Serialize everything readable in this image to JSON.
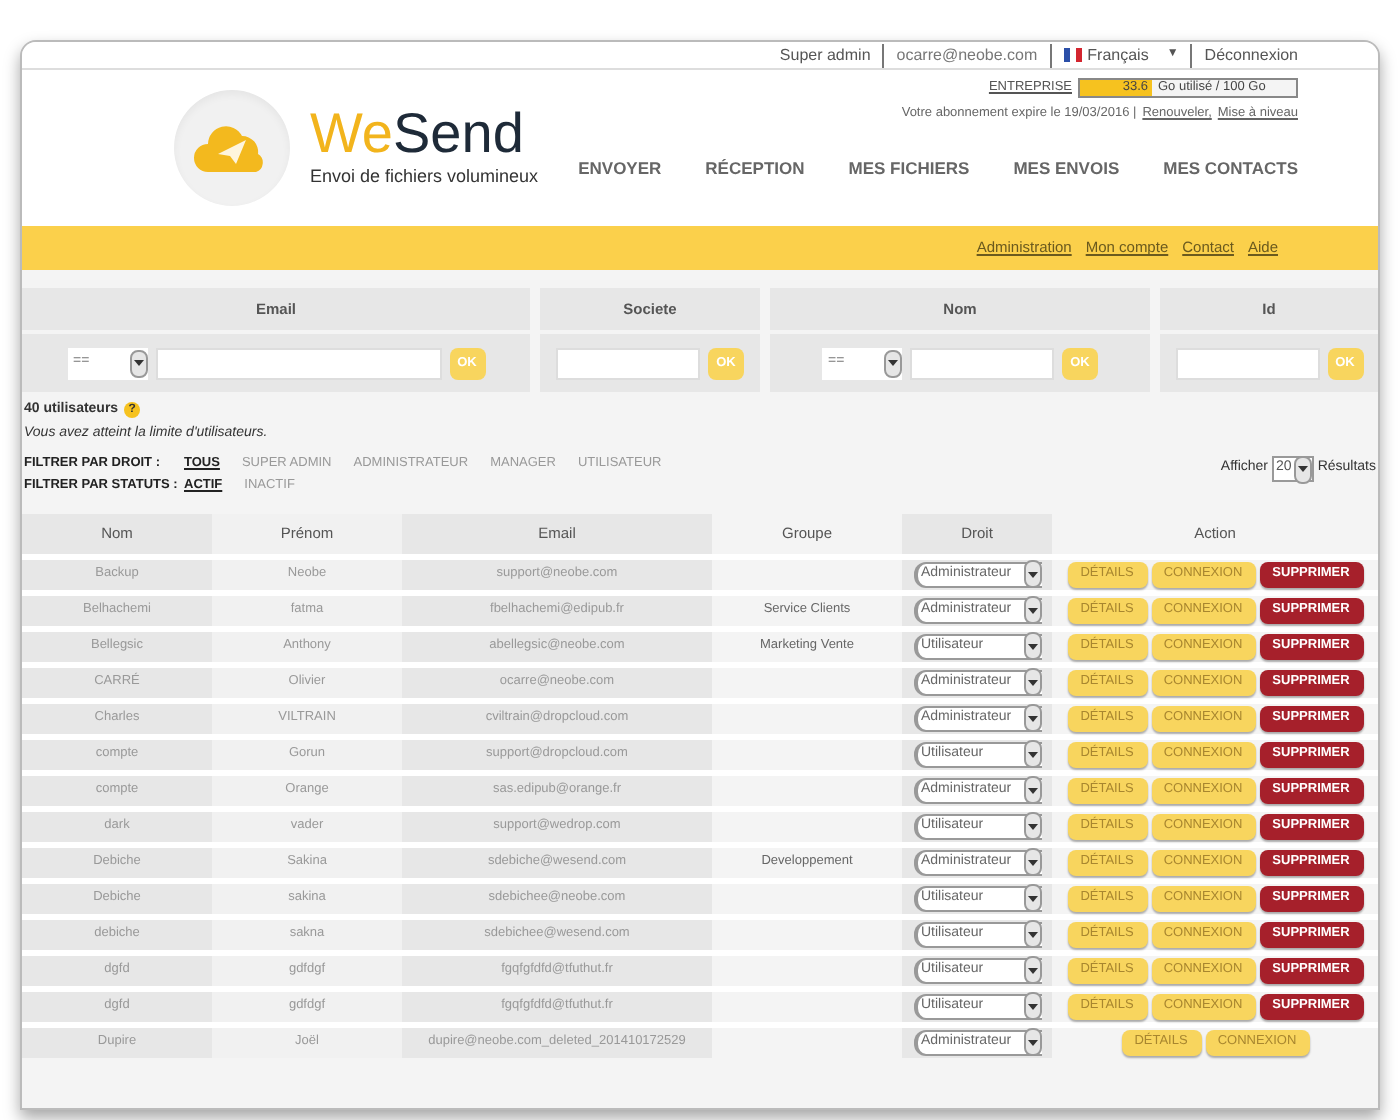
{
  "top_bar": {
    "role": "Super admin",
    "email": "ocarre@neobe.com",
    "language": "Français",
    "language_caret": "▼",
    "logout": "Déconnexion"
  },
  "quota": {
    "plan": "ENTREPRISE",
    "used": "33.6",
    "level": 0.336,
    "label": "Go utilisé / 100 Go"
  },
  "subscription": {
    "text": "Votre abonnement expire le 19/03/2016 |",
    "links": [
      "Renouveler,",
      "Mise à niveau"
    ]
  },
  "logo": {
    "part_1": "We",
    "part_2": "Send",
    "tagline": "Envoi de fichiers volumineux"
  },
  "nav": [
    "ENVOYER",
    "RÉCEPTION",
    "MES FICHIERS",
    "MES ENVOIS",
    "MES CONTACTS"
  ],
  "sub_nav": [
    "Administration",
    "Mon compte",
    "Contact",
    "Aide"
  ],
  "filters": [
    {
      "label": "Email",
      "operator": "==",
      "button": "OK"
    },
    {
      "label": "Societe",
      "button": "OK"
    },
    {
      "label": "Nom",
      "operator": "==",
      "button": "OK"
    },
    {
      "label": "Id",
      "button": "OK"
    }
  ],
  "user_count": "40 utilisateurs",
  "help": "?",
  "limit_note": "Vous avez atteint la limite d'utilisateurs.",
  "right_filter": {
    "label": "FILTRER PAR DROIT :",
    "options": [
      {
        "label": "TOUS",
        "selected": true
      },
      {
        "label": "SUPER ADMIN",
        "selected": false
      },
      {
        "label": "ADMINISTRATEUR",
        "selected": false
      },
      {
        "label": "MANAGER",
        "selected": false
      },
      {
        "label": "UTILISATEUR",
        "selected": false
      }
    ]
  },
  "status_filter": {
    "label": "FILTRER PAR STATUTS :",
    "options": [
      {
        "label": "ACTIF",
        "selected": true
      },
      {
        "label": "INACTIF",
        "selected": false
      }
    ]
  },
  "page_size": {
    "label": "Afficher",
    "value": "20",
    "suffix": "Résultats"
  },
  "table": {
    "columns": [
      "Nom",
      "Prénom",
      "Email",
      "Groupe",
      "Droit",
      "Action"
    ],
    "rows": [
      {
        "nom": "Backup",
        "prenom": "Neobe",
        "email": "support@neobe.com",
        "droit": "Administrateur",
        "actions": [
          {
            "kind": "details",
            "label": "DÉTAILS"
          },
          {
            "kind": "login",
            "label": "CONNEXION"
          },
          {
            "kind": "delete",
            "label": "SUPPRIMER"
          }
        ]
      },
      {
        "nom": "Belhachemi",
        "prenom": "fatma",
        "email": "fbelhachemi@edipub.fr",
        "groupe": "Service Clients",
        "droit": "Administrateur",
        "actions": [
          {
            "kind": "details",
            "label": "DÉTAILS"
          },
          {
            "kind": "login",
            "label": "CONNEXION"
          },
          {
            "kind": "delete",
            "label": "SUPPRIMER"
          }
        ]
      },
      {
        "nom": "Bellegsic",
        "prenom": "Anthony",
        "email": "abellegsic@neobe.com",
        "groupe": "Marketing Vente",
        "droit": "Utilisateur",
        "actions": [
          {
            "kind": "details",
            "label": "DÉTAILS"
          },
          {
            "kind": "login",
            "label": "CONNEXION"
          },
          {
            "kind": "delete",
            "label": "SUPPRIMER"
          }
        ]
      },
      {
        "nom": "CARRÉ",
        "prenom": "Olivier",
        "email": "ocarre@neobe.com",
        "droit": "Administrateur",
        "actions": [
          {
            "kind": "details",
            "label": "DÉTAILS"
          },
          {
            "kind": "login",
            "label": "CONNEXION"
          },
          {
            "kind": "delete",
            "label": "SUPPRIMER"
          }
        ]
      },
      {
        "nom": "Charles",
        "prenom": "VILTRAIN",
        "email": "cviltrain@dropcloud.com",
        "droit": "Administrateur",
        "actions": [
          {
            "kind": "details",
            "label": "DÉTAILS"
          },
          {
            "kind": "login",
            "label": "CONNEXION"
          },
          {
            "kind": "delete",
            "label": "SUPPRIMER"
          }
        ]
      },
      {
        "nom": "compte",
        "prenom": "Gorun",
        "email": "support@dropcloud.com",
        "droit": "Utilisateur",
        "actions": [
          {
            "kind": "details",
            "label": "DÉTAILS"
          },
          {
            "kind": "login",
            "label": "CONNEXION"
          },
          {
            "kind": "delete",
            "label": "SUPPRIMER"
          }
        ]
      },
      {
        "nom": "compte",
        "prenom": "Orange",
        "email": "sas.edipub@orange.fr",
        "droit": "Administrateur",
        "actions": [
          {
            "kind": "details",
            "label": "DÉTAILS"
          },
          {
            "kind": "login",
            "label": "CONNEXION"
          },
          {
            "kind": "delete",
            "label": "SUPPRIMER"
          }
        ]
      },
      {
        "nom": "dark",
        "prenom": "vader",
        "email": "support@wedrop.com",
        "droit": "Utilisateur",
        "actions": [
          {
            "kind": "details",
            "label": "DÉTAILS"
          },
          {
            "kind": "login",
            "label": "CONNEXION"
          },
          {
            "kind": "delete",
            "label": "SUPPRIMER"
          }
        ]
      },
      {
        "nom": "Debiche",
        "prenom": "Sakina",
        "email": "sdebiche@wesend.com",
        "groupe": "Developpement",
        "droit": "Administrateur",
        "actions": [
          {
            "kind": "details",
            "label": "DÉTAILS"
          },
          {
            "kind": "login",
            "label": "CONNEXION"
          },
          {
            "kind": "delete",
            "label": "SUPPRIMER"
          }
        ]
      },
      {
        "nom": "Debiche",
        "prenom": "sakina",
        "email": "sdebichee@neobe.com",
        "droit": "Utilisateur",
        "actions": [
          {
            "kind": "details",
            "label": "DÉTAILS"
          },
          {
            "kind": "login",
            "label": "CONNEXION"
          },
          {
            "kind": "delete",
            "label": "SUPPRIMER"
          }
        ]
      },
      {
        "nom": "debiche",
        "prenom": "sakna",
        "email": "sdebichee@wesend.com",
        "droit": "Utilisateur",
        "actions": [
          {
            "kind": "details",
            "label": "DÉTAILS"
          },
          {
            "kind": "login",
            "label": "CONNEXION"
          },
          {
            "kind": "delete",
            "label": "SUPPRIMER"
          }
        ]
      },
      {
        "nom": "dgfd",
        "prenom": "gdfdgf",
        "email": "fgqfgfdfd@tfuthut.fr",
        "droit": "Utilisateur",
        "actions": [
          {
            "kind": "details",
            "label": "DÉTAILS"
          },
          {
            "kind": "login",
            "label": "CONNEXION"
          },
          {
            "kind": "delete",
            "label": "SUPPRIMER"
          }
        ]
      },
      {
        "nom": "dgfd",
        "prenom": "gdfdgf",
        "email": "fgqfgfdfd@tfuthut.fr",
        "droit": "Utilisateur",
        "actions": [
          {
            "kind": "details",
            "label": "DÉTAILS"
          },
          {
            "kind": "login",
            "label": "CONNEXION"
          },
          {
            "kind": "delete",
            "label": "SUPPRIMER"
          }
        ]
      },
      {
        "nom": "Dupire",
        "prenom": "Joël",
        "email": "dupire@neobe.com_deleted_201410172529",
        "droit": "Administrateur",
        "actions": [
          {
            "kind": "details",
            "label": "DÉTAILS"
          },
          {
            "kind": "login",
            "label": "CONNEXION"
          }
        ]
      }
    ]
  }
}
